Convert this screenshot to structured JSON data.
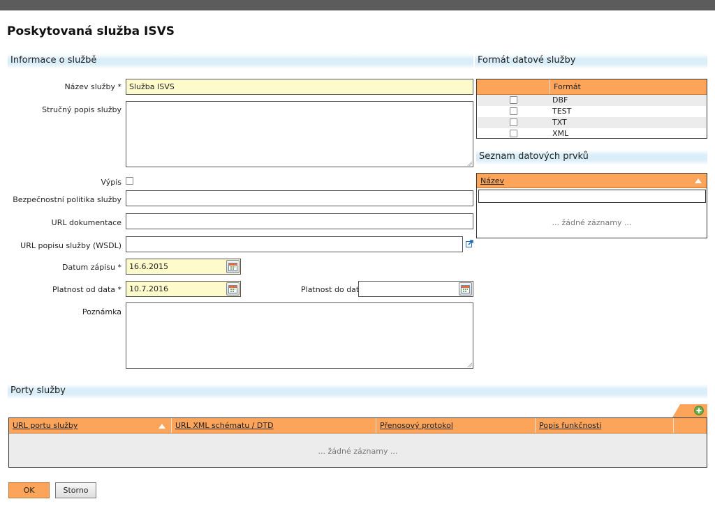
{
  "page": {
    "title": "Poskytovaná služba ISVS"
  },
  "sections": {
    "info": "Informace o službě",
    "format": "Formát datové služby",
    "data_elements": "Seznam datových prvků",
    "ports": "Porty služby"
  },
  "form": {
    "name_label": "Název služby *",
    "name_value": "Služba ISVS",
    "short_desc_label": "Stručný popis služby",
    "short_desc_value": "",
    "listing_label": "Výpis",
    "listing_checked": false,
    "security_label": "Bezpečnostní politika služby",
    "security_value": "",
    "doc_url_label": "URL dokumentace",
    "doc_url_value": "",
    "wsdl_label": "URL popisu služby (WSDL)",
    "wsdl_value": "",
    "record_date_label": "Datum zápisu *",
    "record_date_value": "16.6.2015",
    "valid_from_label": "Platnost od data *",
    "valid_from_value": "10.7.2016",
    "valid_to_label": "Platnost do data",
    "valid_to_value": "",
    "note_label": "Poznámka",
    "note_value": ""
  },
  "format_table": {
    "header": "Formát",
    "rows": [
      {
        "label": "DBF",
        "checked": false
      },
      {
        "label": "TEST",
        "checked": false
      },
      {
        "label": "TXT",
        "checked": false
      },
      {
        "label": "XML",
        "checked": false
      }
    ]
  },
  "data_elements_table": {
    "header": "Název",
    "filter_value": "",
    "empty": "... žádné záznamy ..."
  },
  "ports_table": {
    "columns": [
      "URL portu služby",
      "URL XML schématu / DTD",
      "Přenosový protokol",
      "Popis funkčnosti"
    ],
    "empty": "... žádné záznamy ..."
  },
  "buttons": {
    "ok": "OK",
    "cancel": "Storno"
  },
  "icons": {
    "calendar": "calendar-icon",
    "external_link": "external-link-icon",
    "add": "add-circle-icon",
    "sort": "sort-ascending-icon"
  },
  "colors": {
    "accent_orange": "#fba45a",
    "required_bg": "#fdfbcc",
    "section_band": "#d9eef8",
    "topbar": "#5c5c5c"
  }
}
